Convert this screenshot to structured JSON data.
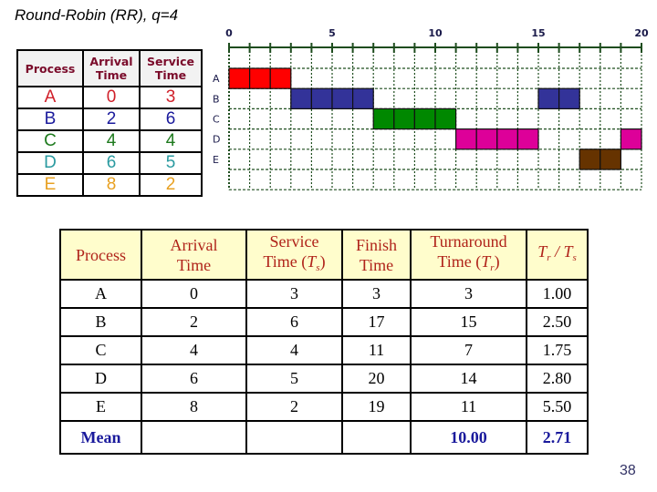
{
  "title": "Round-Robin (RR), q=4",
  "input_table": {
    "headers": [
      "Process",
      "Arrival\nTime",
      "Service\nTime"
    ],
    "header_lines": [
      [
        "Process"
      ],
      [
        "Arrival",
        "Time"
      ],
      [
        "Service",
        "Time"
      ]
    ],
    "rows": [
      {
        "process": "A",
        "arrival": "0",
        "service": "3",
        "color": "#d0202a"
      },
      {
        "process": "B",
        "arrival": "2",
        "service": "6",
        "color": "#1a1a9c"
      },
      {
        "process": "C",
        "arrival": "4",
        "service": "4",
        "color": "#1e7a1e"
      },
      {
        "process": "D",
        "arrival": "6",
        "service": "5",
        "color": "#2a9aa0"
      },
      {
        "process": "E",
        "arrival": "8",
        "service": "2",
        "color": "#e8a020"
      }
    ]
  },
  "chart_data": {
    "type": "gantt",
    "title": "",
    "x_ticks": [
      "0",
      "5",
      "10",
      "15",
      "20"
    ],
    "x_range": [
      0,
      20
    ],
    "rows": [
      "A",
      "B",
      "C",
      "D",
      "E"
    ],
    "grid": true,
    "segments": [
      {
        "process": "A",
        "start": 0,
        "end": 3,
        "color": "#ff0000"
      },
      {
        "process": "B",
        "start": 3,
        "end": 7,
        "color": "#333399"
      },
      {
        "process": "C",
        "start": 7,
        "end": 11,
        "color": "#008800"
      },
      {
        "process": "D",
        "start": 11,
        "end": 15,
        "color": "#dd0099"
      },
      {
        "process": "B",
        "start": 15,
        "end": 17,
        "color": "#333399"
      },
      {
        "process": "E",
        "start": 17,
        "end": 19,
        "color": "#663300"
      },
      {
        "process": "D",
        "start": 19,
        "end": 20,
        "color": "#dd0099"
      }
    ]
  },
  "results_table": {
    "headers": {
      "process": "Process",
      "arrival_1": "Arrival",
      "arrival_2": "Time",
      "service_1": "Service",
      "service_2": "Time (",
      "service_var": "T",
      "service_sub": "s",
      "service_close": ")",
      "finish_1": "Finish",
      "finish_2": "Time",
      "turn_1": "Turnaround",
      "turn_2": "Time (",
      "turn_var": "T",
      "turn_sub": "r",
      "turn_close": ")",
      "ratio_a": "T",
      "ratio_a_sub": "r",
      "ratio_sep": " / ",
      "ratio_b": "T",
      "ratio_b_sub": "s"
    },
    "rows": [
      {
        "process": "A",
        "arrival": "0",
        "service": "3",
        "finish": "3",
        "turnaround": "3",
        "ratio": "1.00"
      },
      {
        "process": "B",
        "arrival": "2",
        "service": "6",
        "finish": "17",
        "turnaround": "15",
        "ratio": "2.50"
      },
      {
        "process": "C",
        "arrival": "4",
        "service": "4",
        "finish": "11",
        "turnaround": "7",
        "ratio": "1.75"
      },
      {
        "process": "D",
        "arrival": "6",
        "service": "5",
        "finish": "20",
        "turnaround": "14",
        "ratio": "2.80"
      },
      {
        "process": "E",
        "arrival": "8",
        "service": "2",
        "finish": "19",
        "turnaround": "11",
        "ratio": "5.50"
      }
    ],
    "mean": {
      "label": "Mean",
      "turnaround": "10.00",
      "ratio": "2.71"
    }
  },
  "page_number": "38"
}
